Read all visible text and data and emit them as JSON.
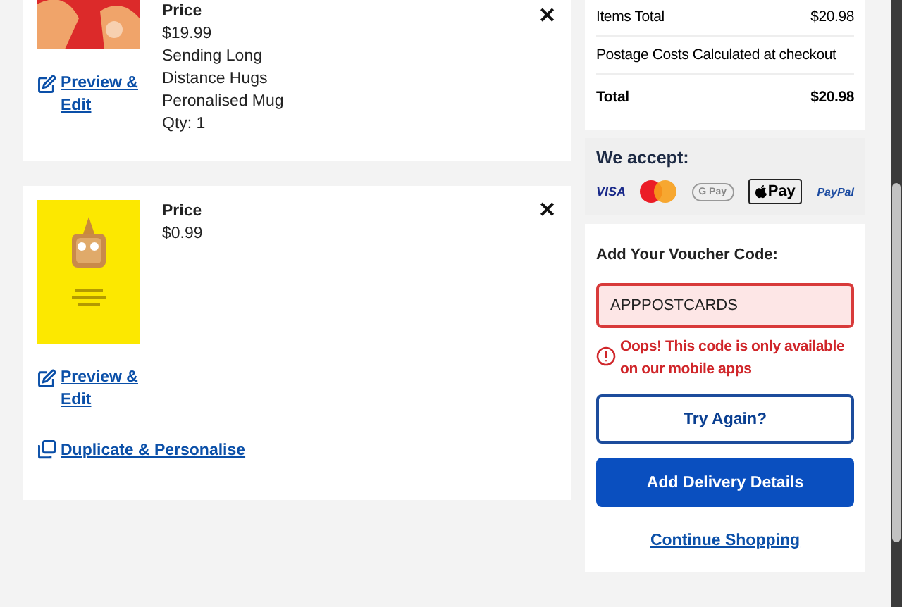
{
  "basket_items": [
    {
      "price_label": "Price",
      "price": "$19.99",
      "details": [
        "Sending Long",
        "Distance Hugs",
        "Peronalised Mug",
        "Qty: 1"
      ],
      "preview_link": "Preview & Edit",
      "remove_label": "✕"
    },
    {
      "price_label": "Price",
      "price": "$0.99",
      "preview_link": "Preview & Edit",
      "duplicate_link": "Duplicate & Personalise",
      "remove_label": "✕"
    }
  ],
  "summary": {
    "rows": [
      {
        "label": "Items Total",
        "value": "$20.98",
        "bold": false
      },
      {
        "label": "Postage Costs Calculated at checkout",
        "bold": false
      },
      {
        "label": "Total",
        "value": "$20.98",
        "bold": true
      }
    ]
  },
  "payments": {
    "title": "We accept:",
    "methods": [
      {
        "kind": "visa",
        "label": "VISA"
      },
      {
        "kind": "mastercard"
      },
      {
        "kind": "gpay",
        "label": "G Pay"
      },
      {
        "kind": "applepay",
        "label": "Pay"
      },
      {
        "kind": "paypal",
        "label": "PayPal"
      }
    ]
  },
  "voucher": {
    "title": "Add Your Voucher Code:",
    "value": "APPPOSTCARDS",
    "error": "Oops! This code is only available on our mobile apps",
    "retry_button": "Try Again?",
    "primary_button": "Add Delivery Details",
    "continue_link": "Continue Shopping"
  }
}
